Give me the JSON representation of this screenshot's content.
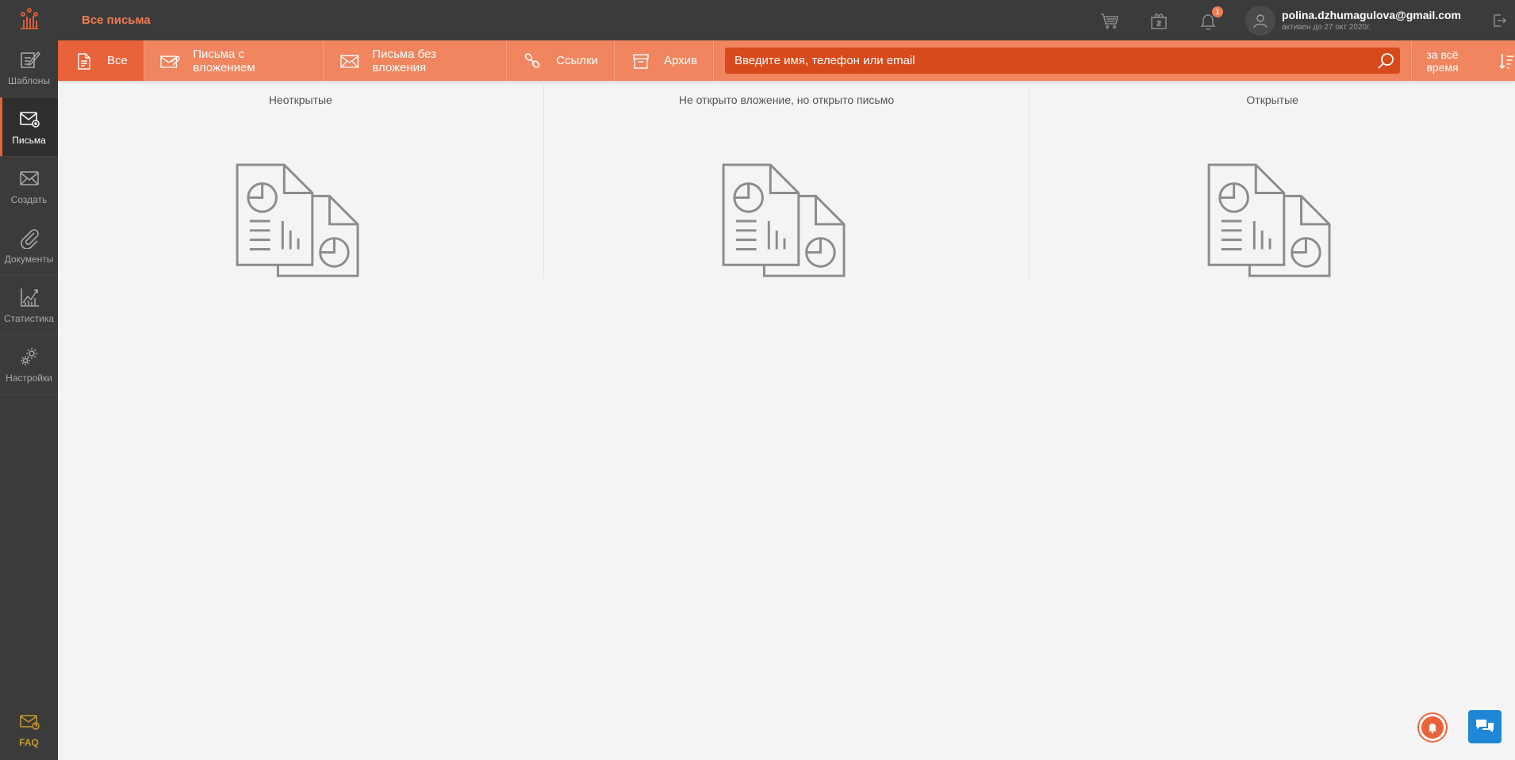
{
  "sidebar": {
    "items": [
      {
        "label": "Шаблоны",
        "icon": "edit-template-icon"
      },
      {
        "label": "Письма",
        "icon": "mail-icon"
      },
      {
        "label": "Создать",
        "icon": "envelope-icon"
      },
      {
        "label": "Документы",
        "icon": "paperclip-icon"
      },
      {
        "label": "Статистика",
        "icon": "chart-icon"
      },
      {
        "label": "Настройки",
        "icon": "gear-icon"
      }
    ],
    "faq": "FAQ"
  },
  "header": {
    "title": "Все письма",
    "notifications_count": "1",
    "user": {
      "email": "polina.dzhumagulova@gmail.com",
      "status": "активен до 27 окт 2020г."
    }
  },
  "filters": {
    "tabs": [
      {
        "label": "Все",
        "icon": "document-icon"
      },
      {
        "label": "Письма с вложением",
        "icon": "mail-attachment-icon"
      },
      {
        "label": "Письма без вложения",
        "icon": "envelope-icon"
      },
      {
        "label": "Ссылки",
        "icon": "link-icon"
      },
      {
        "label": "Архив",
        "icon": "archive-icon"
      }
    ],
    "search_placeholder": "Введите имя, телефон или email",
    "period": "за всё время"
  },
  "columns": [
    {
      "title": "Неоткрытые"
    },
    {
      "title": "Не открыто вложение, но открыто письмо"
    },
    {
      "title": "Открытые"
    }
  ],
  "colors": {
    "accent": "#f0855f",
    "accent_dark": "#e8623a",
    "sidebar_bg": "#3b3b3b",
    "chat_button": "#1e88d6"
  }
}
